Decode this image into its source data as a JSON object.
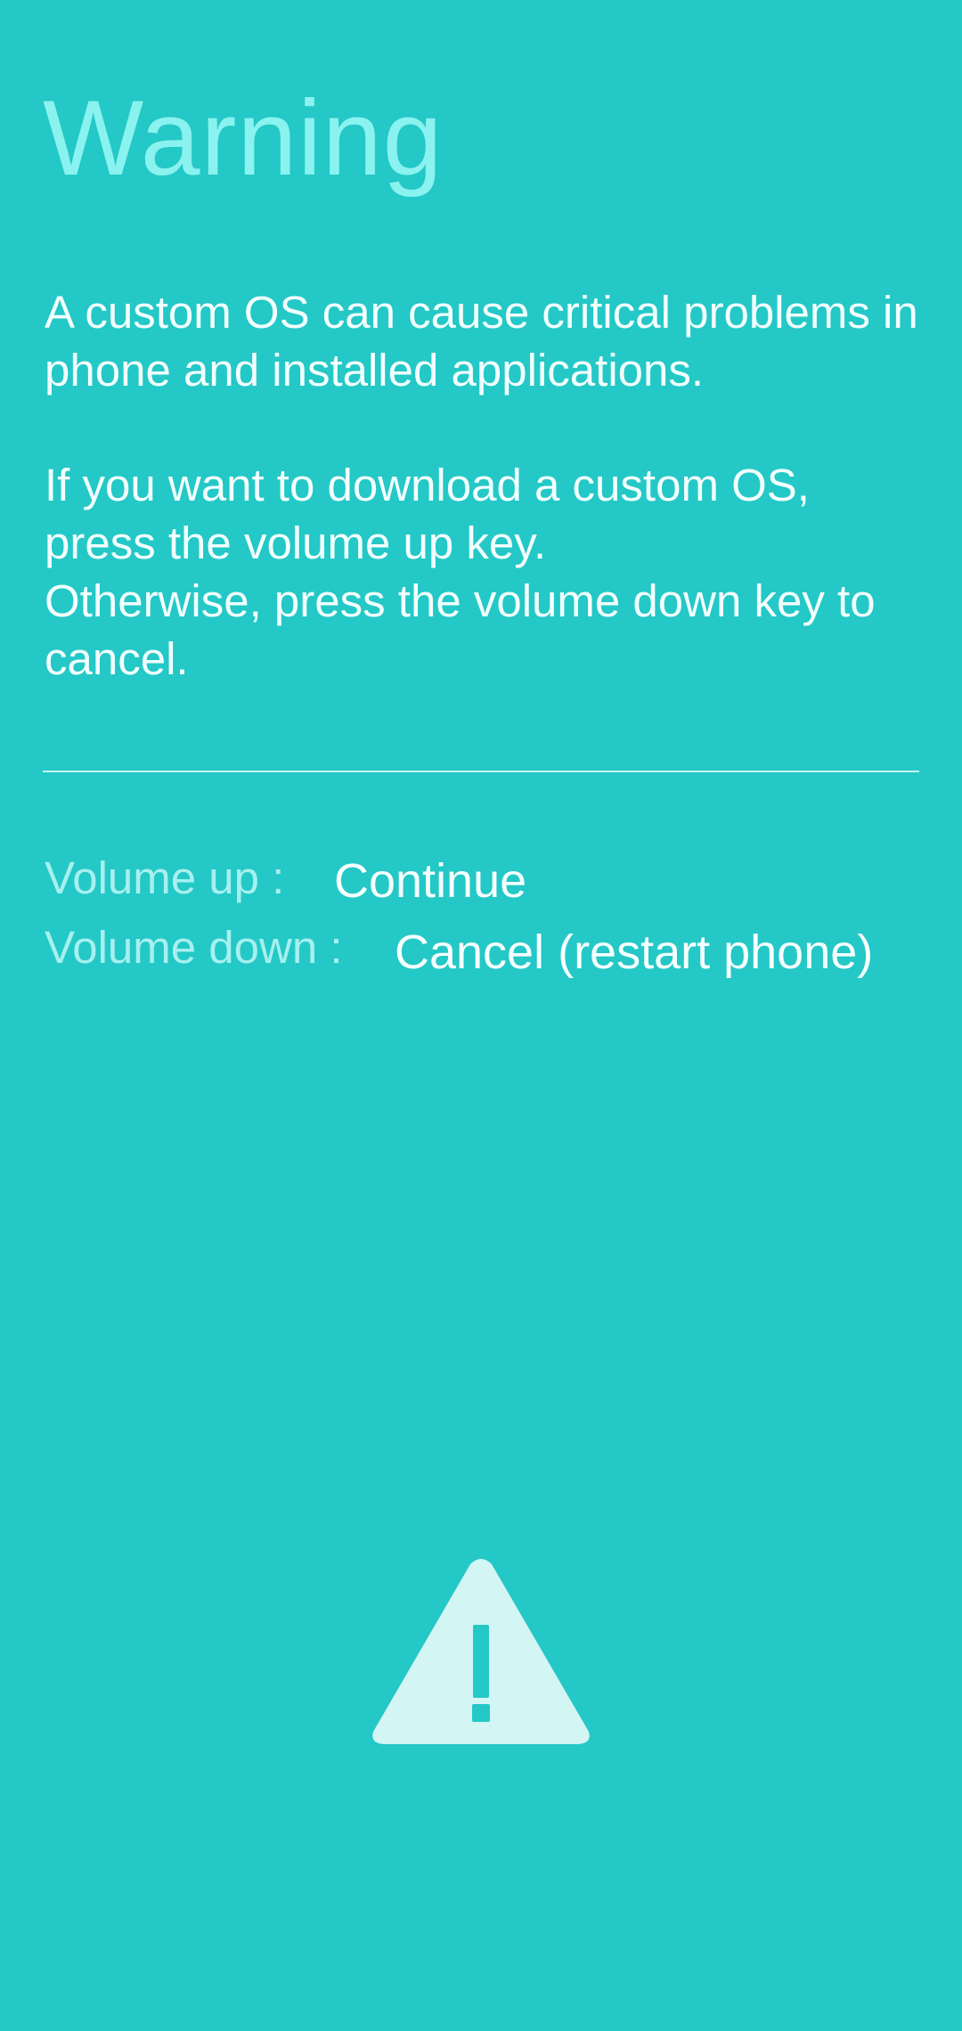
{
  "screen": {
    "title": "Warning",
    "message_1": "A custom OS can cause critical problems in phone and installed applications.",
    "message_2_line1": "If you want to download a custom OS, press the volume up key.",
    "message_2_line2": "Otherwise, press the volume down key to cancel."
  },
  "options": {
    "volume_up_label": "Volume up :",
    "volume_up_action": "Continue",
    "volume_down_label": "Volume down :",
    "volume_down_action": "Cancel (restart phone)"
  },
  "icon": {
    "name": "warning-triangle-icon",
    "color": "#d3f5f4",
    "glyph_color": "#24c8c6"
  },
  "colors": {
    "background": "#24c8c6",
    "title": "#8af2ef",
    "text": "#f2ffff",
    "label": "#a6f0ee"
  }
}
